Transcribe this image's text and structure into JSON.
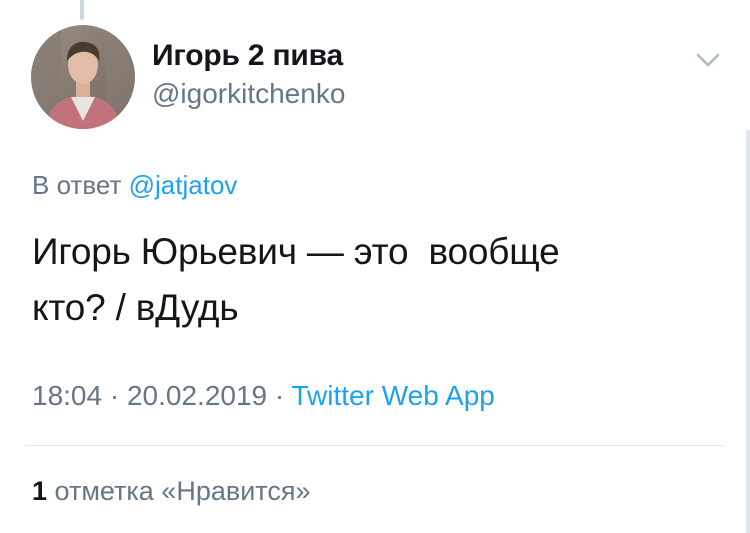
{
  "author": {
    "display_name": "Игорь 2 пива",
    "handle": "@igorkitchenko"
  },
  "reply": {
    "prefix": "В ответ",
    "mention": "@jatjatov"
  },
  "tweet": {
    "text": "Игорь Юрьевич — это  вообще\nкто? / вДудь"
  },
  "meta": {
    "time": "18:04",
    "separator_1": " · ",
    "date": "20.02.2019",
    "separator_2": " · ",
    "source": "Twitter Web App"
  },
  "likes": {
    "count": "1",
    "label": "отметка «Нравится»"
  },
  "colors": {
    "accent": "#1da1f2",
    "secondary_text": "#657786",
    "primary_text": "#14171a",
    "divider": "#e1e8ed"
  },
  "icons": {
    "menu": "chevron-down-icon",
    "avatar": "avatar"
  }
}
